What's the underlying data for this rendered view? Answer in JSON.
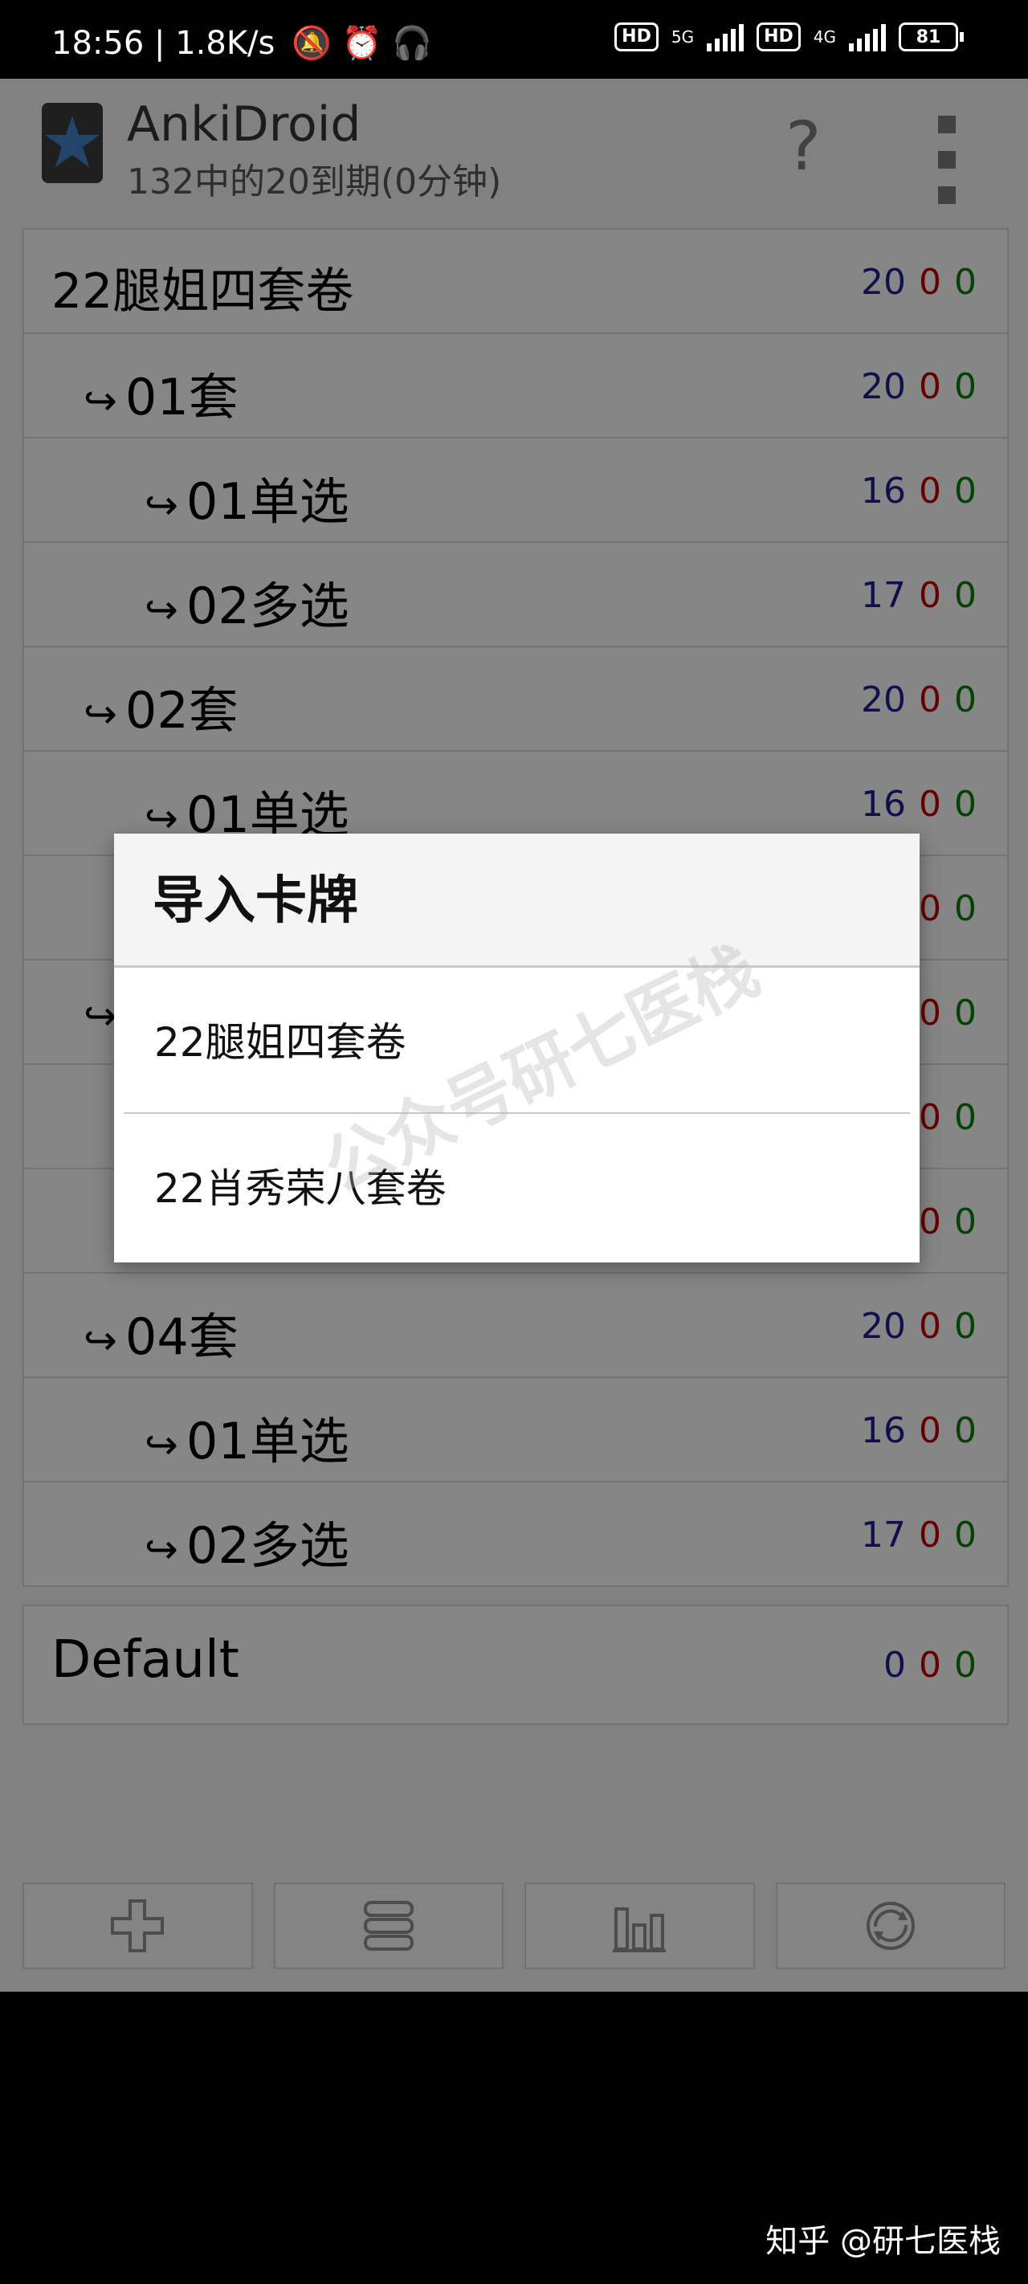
{
  "status_bar": {
    "time": "18:56",
    "speed": "1.8K/s",
    "hd1": "HD",
    "net1": "5G",
    "hd2": "HD",
    "net2": "4G",
    "battery": "81"
  },
  "toolbar": {
    "title": "AnkiDroid",
    "subtitle": "132中的20到期(0分钟)",
    "help_icon": "?"
  },
  "decks": [
    {
      "name": "22腿姐四套卷",
      "level": 0,
      "new": "20",
      "learn": "0",
      "review": "0"
    },
    {
      "name": "01套",
      "level": 1,
      "new": "20",
      "learn": "0",
      "review": "0"
    },
    {
      "name": "01单选",
      "level": 2,
      "new": "16",
      "learn": "0",
      "review": "0"
    },
    {
      "name": "02多选",
      "level": 2,
      "new": "17",
      "learn": "0",
      "review": "0"
    },
    {
      "name": "02套",
      "level": 1,
      "new": "20",
      "learn": "0",
      "review": "0"
    },
    {
      "name": "01单选",
      "level": 2,
      "new": "16",
      "learn": "0",
      "review": "0"
    },
    {
      "name": "",
      "level": 2,
      "new": "",
      "learn": "0",
      "review": "0"
    },
    {
      "name": "",
      "level": 1,
      "new": "",
      "learn": "0",
      "review": "0"
    },
    {
      "name": "",
      "level": 2,
      "new": "",
      "learn": "0",
      "review": "0"
    },
    {
      "name": "",
      "level": 2,
      "new": "",
      "learn": "0",
      "review": "0"
    },
    {
      "name": "04套",
      "level": 1,
      "new": "20",
      "learn": "0",
      "review": "0"
    },
    {
      "name": "01单选",
      "level": 2,
      "new": "16",
      "learn": "0",
      "review": "0"
    },
    {
      "name": "02多选",
      "level": 2,
      "new": "17",
      "learn": "0",
      "review": "0"
    }
  ],
  "default_deck": {
    "name": "Default",
    "new": "0",
    "learn": "0",
    "review": "0"
  },
  "bottom_bar": [
    "add-icon",
    "decks-icon",
    "stats-icon",
    "sync-icon"
  ],
  "dialog": {
    "title": "导入卡牌",
    "items": [
      "22腿姐四套卷",
      "22肖秀荣八套卷"
    ]
  },
  "watermark": "公众号研七医栈",
  "corner_watermark": "知乎 @研七医栈",
  "colors": {
    "new": "#1e1e8e",
    "learn": "#bb0000",
    "review": "#0a7a0a",
    "dim": "rgba(0,0,0,0.45)"
  }
}
